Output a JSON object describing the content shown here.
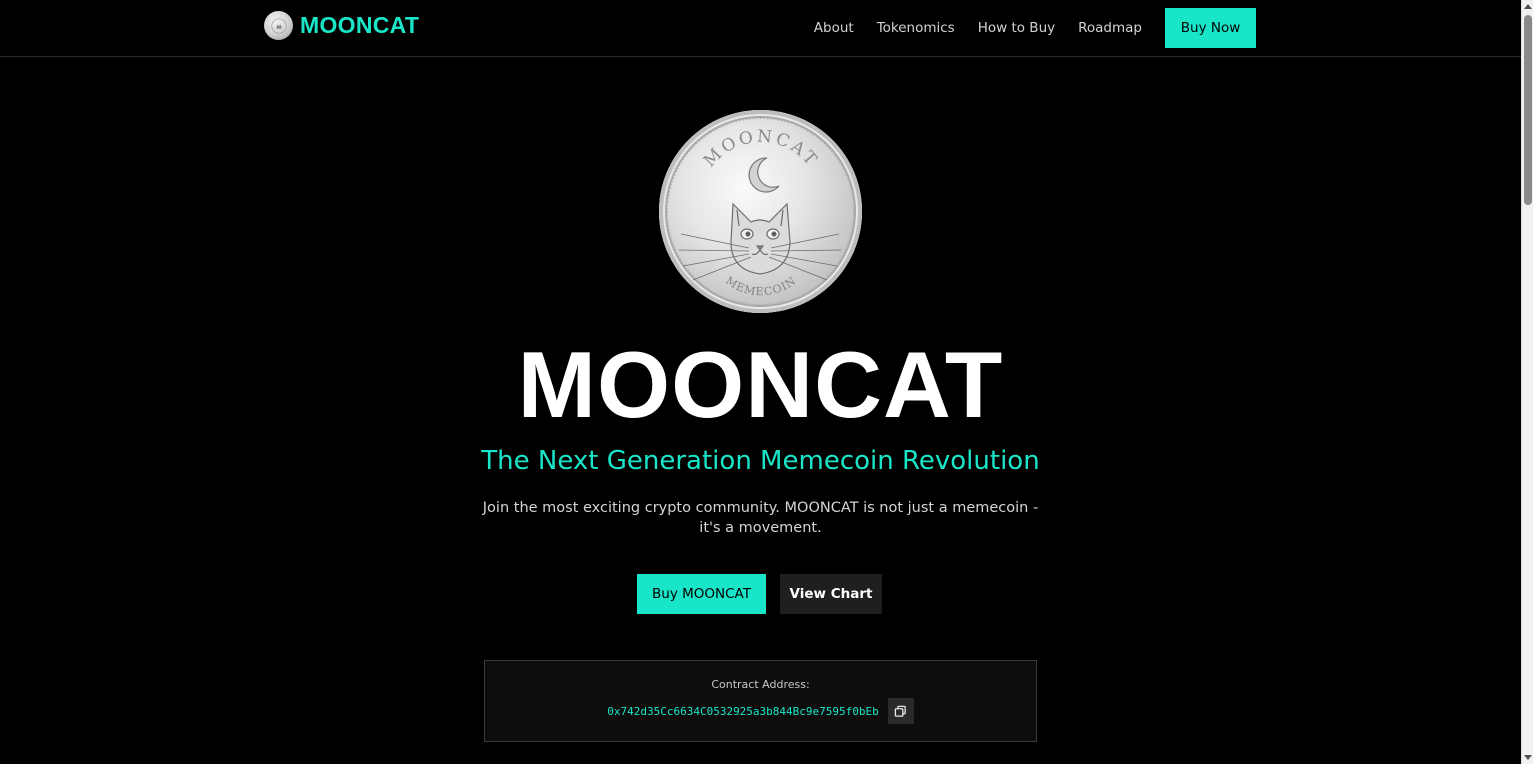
{
  "brand": {
    "name": "MOONCAT",
    "logo_icon": "coin-logo-icon"
  },
  "nav": {
    "links": [
      "About",
      "Tokenomics",
      "How to Buy",
      "Roadmap"
    ],
    "buy_label": "Buy Now"
  },
  "hero": {
    "coin_icon": "mooncat-coin-icon",
    "coin_top_text": "MOONCAT",
    "coin_bottom_text": "MEMECOIN",
    "title": "MOONCAT",
    "subtitle": "The Next Generation Memecoin Revolution",
    "description": "Join the most exciting crypto community. MOONCAT is not just a memecoin - it's a movement.",
    "primary_button": "Buy MOONCAT",
    "secondary_button": "View Chart"
  },
  "contract": {
    "label": "Contract Address:",
    "address": "0x742d35Cc6634C0532925a3b844Bc9e7595f0bEb",
    "copy_icon": "copy-icon"
  },
  "colors": {
    "accent": "#19e6c8",
    "background": "#000000",
    "secondary_button": "#1f1f1f"
  }
}
